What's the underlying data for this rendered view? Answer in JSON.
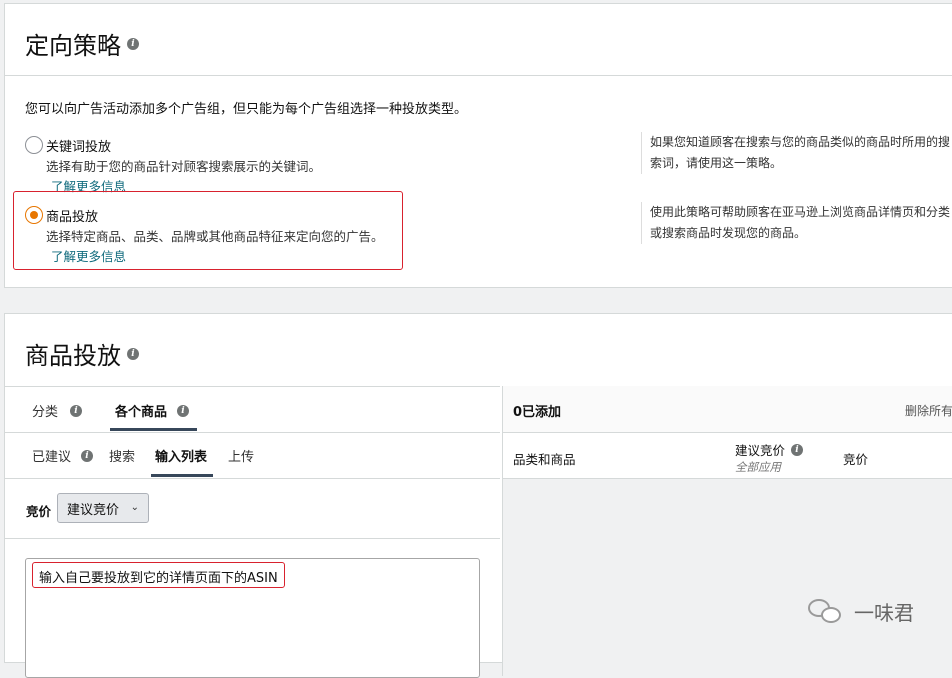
{
  "strategy": {
    "title": "定向策略",
    "intro": "您可以向广告活动添加多个广告组，但只能为每个广告组选择一种投放类型。",
    "options": [
      {
        "title": "关键词投放",
        "desc": "选择有助于您的商品针对顾客搜索展示的关键词。",
        "link": "了解更多信息",
        "note": "如果您知道顾客在搜索与您的商品类似的商品时所用的搜索词，请使用这一策略。",
        "selected": false
      },
      {
        "title": "商品投放",
        "desc": "选择特定商品、品类、品牌或其他商品特征来定向您的广告。",
        "link": "了解更多信息",
        "note": "使用此策略可帮助顾客在亚马逊上浏览商品详情页和分类或搜索商品时发现您的商品。",
        "selected": true
      }
    ]
  },
  "product_targeting": {
    "title": "商品投放",
    "main_tabs": [
      {
        "label": "分类",
        "active": false
      },
      {
        "label": "各个商品",
        "active": true
      }
    ],
    "sub_tabs": [
      {
        "label": "已建议",
        "active": false
      },
      {
        "label": "搜索",
        "active": false
      },
      {
        "label": "输入列表",
        "active": true
      },
      {
        "label": "上传",
        "active": false
      }
    ],
    "bid_label": "竞价",
    "bid_dropdown": "建议竞价",
    "input_text": "输入自己要投放到它的详情页面下的ASIN",
    "right": {
      "added": "0已添加",
      "remove_all": "删除所有",
      "col_product": "品类和商品",
      "col_suggested": "建议竞价",
      "col_suggested_sub": "全部应用",
      "col_bid": "竞价"
    }
  },
  "watermark": "一味君",
  "colors": {
    "accent_orange": "#e77600",
    "link_teal": "#0f6a7c",
    "annotation_red": "#d8222e",
    "tab_underline": "#37475a"
  }
}
